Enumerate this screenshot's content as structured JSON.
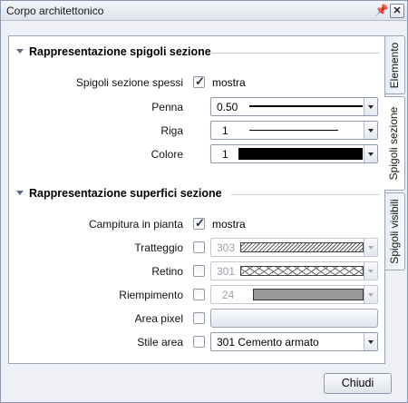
{
  "window": {
    "title": "Corpo architettonico"
  },
  "section1": {
    "title": "Rappresentazione spigoli sezione",
    "rows": {
      "spessi": {
        "label": "Spigoli sezione spessi",
        "checked": true,
        "checkbox_label": "mostra"
      },
      "penna": {
        "label": "Penna",
        "value": "0.50"
      },
      "riga": {
        "label": "Riga",
        "value": "1"
      },
      "colore": {
        "label": "Colore",
        "value": "1",
        "swatch_color": "#000000"
      }
    }
  },
  "section2": {
    "title": "Rappresentazione superfici sezione",
    "rows": {
      "campitura": {
        "label": "Campitura in pianta",
        "checked": true,
        "checkbox_label": "mostra"
      },
      "tratteggio": {
        "label": "Tratteggio",
        "checked": false,
        "value": "303",
        "enabled": false
      },
      "retino": {
        "label": "Retino",
        "checked": false,
        "value": "301",
        "enabled": false
      },
      "riempimento": {
        "label": "Riempimento",
        "checked": false,
        "value": "24",
        "enabled": false,
        "swatch_color": "#9a9a9a"
      },
      "area_pixel": {
        "label": "Area pixel",
        "checked": false
      },
      "stile_area": {
        "label": "Stile area",
        "checked": false,
        "value": "301 Cemento armato"
      }
    }
  },
  "tabs": [
    "Elemento",
    "Spigoli sezione",
    "Spigoli visibili"
  ],
  "active_tab": "Spigoli sezione",
  "footer": {
    "close_label": "Chiudi"
  },
  "icons": {
    "pin": "pin-icon",
    "close": "close-icon"
  }
}
